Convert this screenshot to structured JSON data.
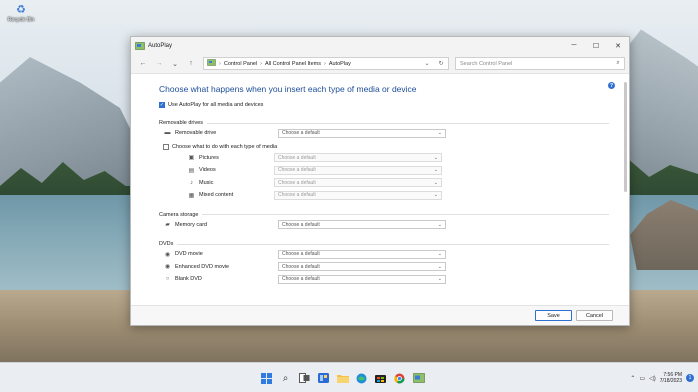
{
  "desktop": {
    "recycle_bin_label": "Recycle Bin"
  },
  "window": {
    "title": "AutoPlay",
    "breadcrumbs": [
      "Control Panel",
      "All Control Panel Items",
      "AutoPlay"
    ],
    "search_placeholder": "Search Control Panel",
    "heading": "Choose what happens when you insert each type of media or device",
    "use_autoplay_label": "Use AutoPlay for all media and devices",
    "sections": {
      "removable": {
        "title": "Removable drives",
        "drive_label": "Removable drive",
        "drive_value": "Choose a default",
        "each_type_label": "Choose what to do with each type of media",
        "media": [
          {
            "label": "Pictures",
            "value": "Choose a default"
          },
          {
            "label": "Videos",
            "value": "Choose a default"
          },
          {
            "label": "Music",
            "value": "Choose a default"
          },
          {
            "label": "Mixed content",
            "value": "Choose a default"
          }
        ]
      },
      "camera": {
        "title": "Camera storage",
        "memory_card_label": "Memory card",
        "memory_card_value": "Choose a default"
      },
      "dvds": {
        "title": "DVDs",
        "items": [
          {
            "label": "DVD movie",
            "value": "Choose a default"
          },
          {
            "label": "Enhanced DVD movie",
            "value": "Choose a default"
          },
          {
            "label": "Blank DVD",
            "value": "Choose a default"
          }
        ]
      }
    },
    "footer": {
      "save_label": "Save",
      "cancel_label": "Cancel"
    }
  },
  "taskbar": {
    "time": "7:56 PM",
    "date": "7/18/2023",
    "notification_count": "1"
  }
}
